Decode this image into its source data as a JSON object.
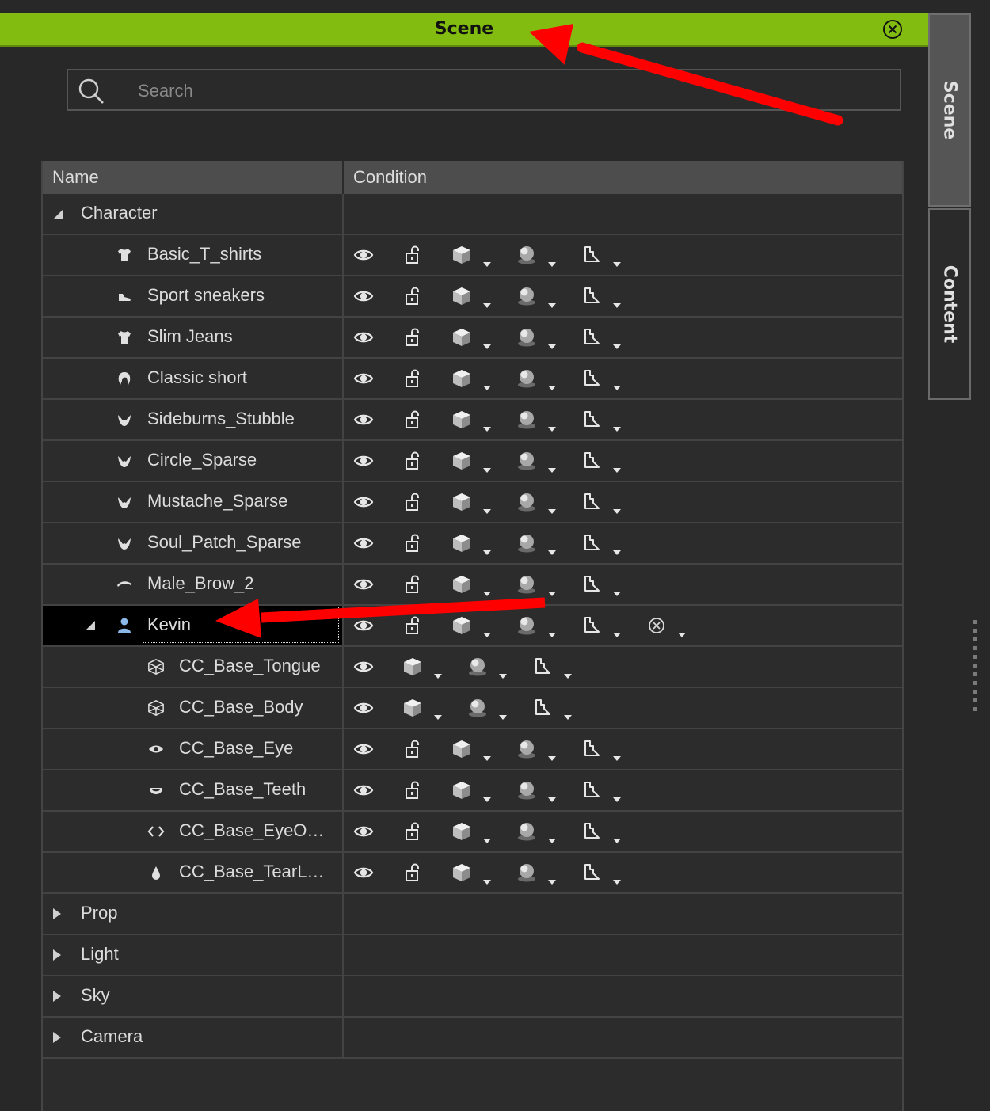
{
  "window": {
    "title": "Scene"
  },
  "search": {
    "placeholder": "Search"
  },
  "columns": {
    "name": "Name",
    "condition": "Condition"
  },
  "side_tabs": {
    "scene": "Scene",
    "content": "Content"
  },
  "colors": {
    "titlebar": "#82bc10",
    "background": "#282828",
    "arrow": "#ff0000",
    "selected_row": "#000000"
  },
  "tree": {
    "character": "Character",
    "items": [
      {
        "label": "Basic_T_shirts",
        "icon": "shirt-icon"
      },
      {
        "label": "Sport sneakers",
        "icon": "shoe-icon"
      },
      {
        "label": "Slim Jeans",
        "icon": "shirt-icon"
      },
      {
        "label": "Classic short",
        "icon": "hair-icon"
      },
      {
        "label": "Sideburns_Stubble",
        "icon": "beard-icon"
      },
      {
        "label": "Circle_Sparse",
        "icon": "beard-icon"
      },
      {
        "label": "Mustache_Sparse",
        "icon": "beard-icon"
      },
      {
        "label": "Soul_Patch_Sparse",
        "icon": "beard-icon"
      },
      {
        "label": "Male_Brow_2",
        "icon": "brow-icon"
      }
    ],
    "kevin": "Kevin",
    "kevin_items": [
      {
        "label": "CC_Base_Tongue",
        "icon": "mesh-icon"
      },
      {
        "label": "CC_Base_Body",
        "icon": "mesh-icon"
      },
      {
        "label": "CC_Base_Eye",
        "icon": "eye-icon"
      },
      {
        "label": "CC_Base_Teeth",
        "icon": "teeth-icon"
      },
      {
        "label": "CC_Base_EyeO…",
        "icon": "eye-occlusion-icon"
      },
      {
        "label": "CC_Base_TearL…",
        "icon": "tear-icon"
      }
    ],
    "groups": [
      "Prop",
      "Light",
      "Sky",
      "Camera"
    ]
  }
}
